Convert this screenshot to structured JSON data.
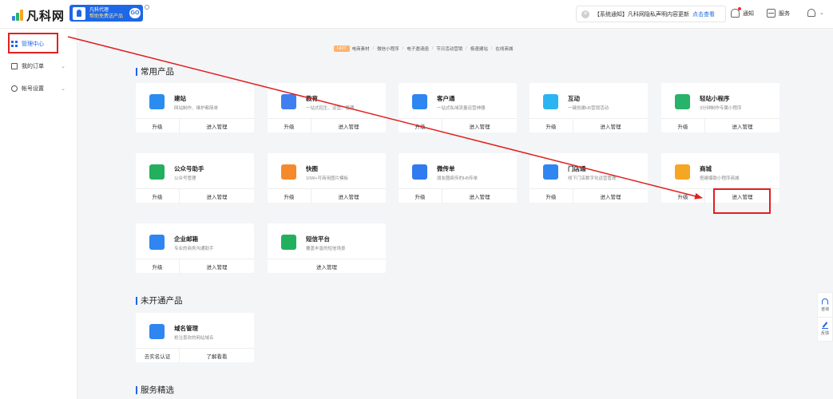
{
  "brand": {
    "logo_text": "凡科网"
  },
  "promo": {
    "line1": "凡科代理",
    "line2": "帮助免费送产品",
    "go": "GO"
  },
  "notice": {
    "text": "【系统通知】凡科网隐私声明内容更新",
    "link": "点击查看"
  },
  "topnav": {
    "notify": "通知",
    "service": "服务"
  },
  "sidebar": {
    "items": [
      {
        "label": "管理中心",
        "active": true
      },
      {
        "label": "我的订单"
      },
      {
        "label": "帐号设置"
      }
    ]
  },
  "breadcrumb": {
    "hot": "HOT",
    "items": [
      "电商素材",
      "微信小程序",
      "电子邀请函",
      "节日活动营销",
      "极速建站",
      "在线商城"
    ]
  },
  "sections": {
    "common": "常用产品",
    "inactive": "未开通产品",
    "selected": "服务精选"
  },
  "cards": [
    {
      "title": "建站",
      "desc": "网站制作、维护都简单",
      "left": "升级",
      "right": "进入管理",
      "icon": "website-icon",
      "color": "#2b8cf0"
    },
    {
      "title": "教育",
      "desc": "一站式招生、运营、管理",
      "left": "升级",
      "right": "进入管理",
      "icon": "education-icon",
      "color": "#3f7ff0"
    },
    {
      "title": "客户通",
      "desc": "一站式私域流量运营神器",
      "left": "升级",
      "right": "进入管理",
      "icon": "customer-icon",
      "color": "#2f86f0"
    },
    {
      "title": "互动",
      "desc": "一键创建H5营销活动",
      "left": "升级",
      "right": "进入管理",
      "icon": "gift-icon",
      "color": "#2bb4f2"
    },
    {
      "title": "轻站小程序",
      "desc": "3分钟制作专属小程序",
      "left": "升级",
      "right": "进入管理",
      "icon": "mini-program-icon",
      "color": "#27b36a"
    },
    {
      "title": "公众号助手",
      "desc": "公众号管理",
      "left": "升级",
      "right": "进入管理",
      "icon": "wechat-assistant-icon",
      "color": "#22b05f"
    },
    {
      "title": "快图",
      "desc": "10W+可商用图片模板",
      "left": "升级",
      "right": "进入管理",
      "icon": "image-icon",
      "color": "#f58a2c"
    },
    {
      "title": "微传单",
      "desc": "朋友圈疯传的H5传单",
      "left": "升级",
      "right": "进入管理",
      "icon": "h5-flyer-icon",
      "color": "#2f7bef"
    },
    {
      "title": "门店通",
      "desc": "线下门店数字化运营管理",
      "left": "升级",
      "right": "进入管理",
      "icon": "store-icon",
      "color": "#2f86f0"
    },
    {
      "title": "商城",
      "desc": "搭建爆款小程序商城",
      "left": "升级",
      "right": "进入管理",
      "icon": "mall-icon",
      "color": "#f5a623"
    },
    {
      "title": "企业邮箱",
      "desc": "专业的商务沟通助手",
      "left": "升级",
      "right": "进入管理",
      "icon": "email-icon",
      "color": "#2f86f0"
    },
    {
      "title": "短信平台",
      "desc": "覆盖丰富的短信场景",
      "left": "",
      "right": "进入管理",
      "icon": "sms-icon",
      "color": "#22b05f"
    },
    {
      "title": "域名管理",
      "desc": "抢注喜欢的网站域名",
      "left": "去实名认证",
      "right": "了解看看",
      "icon": "domain-icon",
      "color": "#2f86f0"
    }
  ],
  "floaters": {
    "consult": "咨询",
    "feedback": "反馈"
  },
  "annotation": {
    "color": "#e02020"
  }
}
